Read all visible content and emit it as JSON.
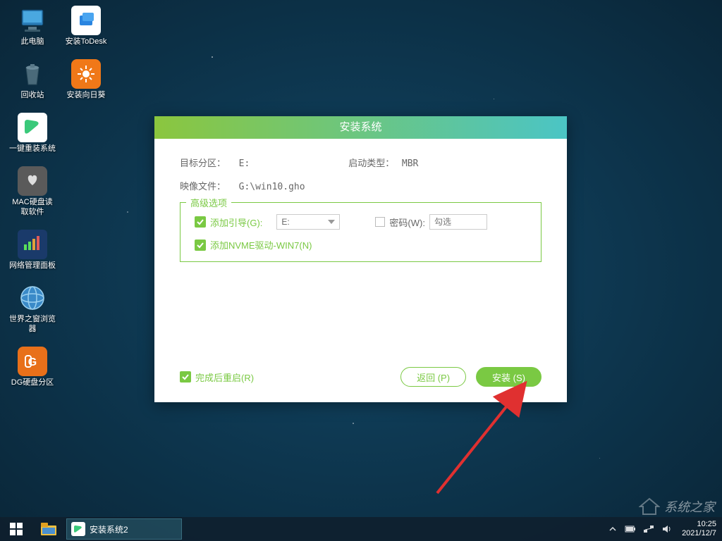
{
  "desktop": {
    "col1": [
      {
        "label": "此电脑"
      },
      {
        "label": "回收站"
      },
      {
        "label": "一键重装系统"
      },
      {
        "label": "MAC硬盘读取软件"
      },
      {
        "label": "网络管理面板"
      },
      {
        "label": "世界之窗浏览器"
      },
      {
        "label": "DG硬盘分区"
      }
    ],
    "col2": [
      {
        "label": "安装ToDesk"
      },
      {
        "label": "安装向日葵"
      }
    ]
  },
  "dialog": {
    "title": "安装系统",
    "target_partition_label": "目标分区：",
    "target_partition_value": "E:",
    "boot_type_label": "启动类型：",
    "boot_type_value": "MBR",
    "image_file_label": "映像文件：",
    "image_file_value": "G:\\win10.gho",
    "advanced_legend": "高级选项",
    "add_boot_label": "添加引导(G):",
    "add_boot_drive": "E:",
    "password_label": "密码(W):",
    "password_placeholder": "勾选",
    "nvme_label": "添加NVME驱动-WIN7(N)",
    "restart_label": "完成后重启(R)",
    "back_button": "返回 (P)",
    "install_button": "安装 (S)"
  },
  "taskbar": {
    "task_label": "安装系统2",
    "time": "10:25",
    "date": "2021/12/7"
  },
  "watermark": "系统之家"
}
